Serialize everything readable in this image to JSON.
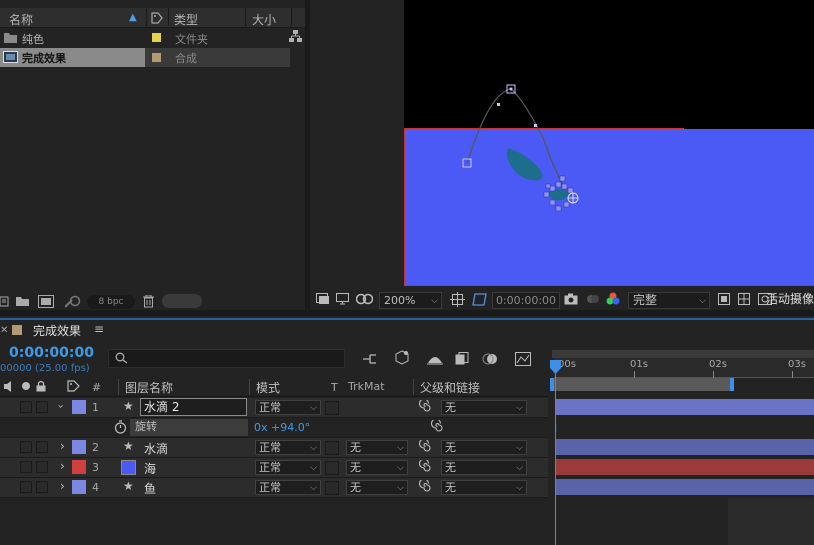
{
  "project": {
    "headers": {
      "name": "名称",
      "type": "类型",
      "size": "大小"
    },
    "items": [
      {
        "name": "纯色",
        "type": "文件夹",
        "color": "#e6d24a"
      },
      {
        "name": "完成效果",
        "type": "合成",
        "color": "#b49a73"
      }
    ],
    "bpc": "8 bpc"
  },
  "viewer": {
    "zoom": "200%",
    "timecode": "0:00:00:00",
    "resolution": "完整",
    "camera": "活动摄像"
  },
  "timeline": {
    "tab_title": "完成效果",
    "current_time": "0:00:00:00",
    "fps_info": "00000 (25.00 fps)",
    "search_placeholder": "",
    "headers": {
      "hash": "#",
      "layer_name": "图层名称",
      "mode": "模式",
      "t": "T",
      "trkmat": "TrkMat",
      "parent": "父级和链接"
    },
    "ruler": [
      "00s",
      "01s",
      "02s",
      "03s"
    ],
    "layers": [
      {
        "num": "1",
        "name": "水滴 2",
        "mode": "正常",
        "trkmat": "",
        "parent": "无",
        "color": "#7b87e0"
      },
      {
        "num": "2",
        "name": "水滴",
        "mode": "正常",
        "trkmat": "无",
        "parent": "无",
        "color": "#7b87e0"
      },
      {
        "num": "3",
        "name": "海",
        "mode": "正常",
        "trkmat": "无",
        "parent": "无",
        "color": "#d04040"
      },
      {
        "num": "4",
        "name": "鱼",
        "mode": "正常",
        "trkmat": "无",
        "parent": "无",
        "color": "#7b87e0"
      }
    ],
    "property": {
      "name": "旋转",
      "value": "0x +94.0°"
    }
  }
}
